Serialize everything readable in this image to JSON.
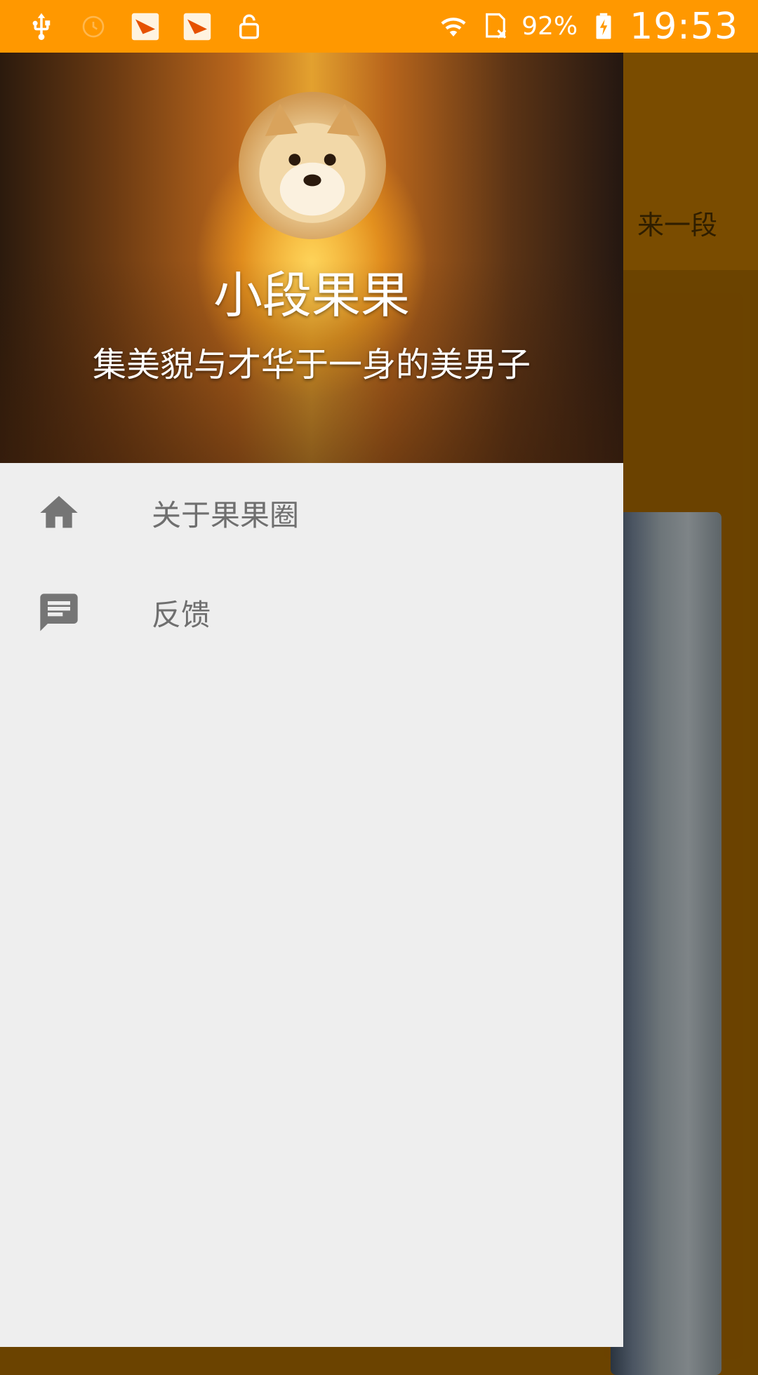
{
  "status_bar": {
    "battery_percent": "92%",
    "time": "19:53",
    "icons": [
      "usb-icon",
      "alarm-icon",
      "app-notification-icon",
      "app-notification-icon",
      "lock-icon",
      "wifi-icon",
      "sim-no-signal-icon",
      "battery-charging-icon"
    ]
  },
  "background_app": {
    "tab_label": "来一段"
  },
  "drawer": {
    "username": "小段果果",
    "bio": "集美貌与才华于一身的美男子",
    "menu": [
      {
        "label": "关于果果圈",
        "icon": "home-icon"
      },
      {
        "label": "反馈",
        "icon": "feedback-icon"
      }
    ]
  },
  "colors": {
    "status_bar": "#FF9800",
    "drawer_bg": "#EEEEEE",
    "menu_text": "#6F6F6F"
  }
}
